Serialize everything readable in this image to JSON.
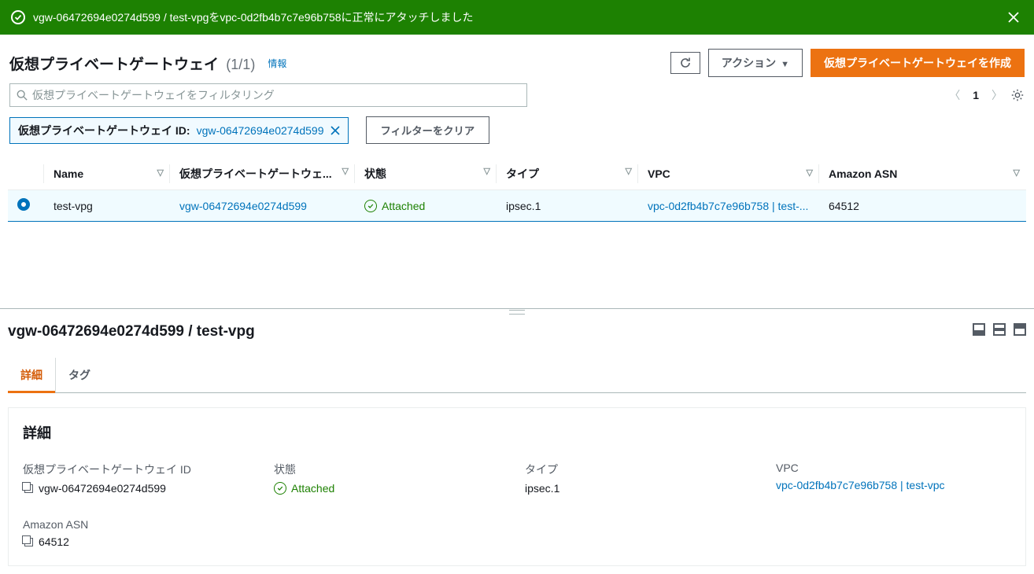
{
  "flash": {
    "message": "vgw-06472694e0274d599 / test-vpgをvpc-0d2fb4b7c7e96b758に正常にアタッチしました"
  },
  "header": {
    "title": "仮想プライベートゲートウェイ",
    "count": "(1/1)",
    "info_link": "情報",
    "actions_label": "アクション",
    "create_label": "仮想プライベートゲートウェイを作成"
  },
  "filter": {
    "placeholder": "仮想プライベートゲートウェイをフィルタリング",
    "token_key": "仮想プライベートゲートウェイ ID:",
    "token_value": "vgw-06472694e0274d599",
    "clear_label": "フィルターをクリア",
    "page_number": "1"
  },
  "table": {
    "columns": {
      "name": "Name",
      "vgw_id": "仮想プライベートゲートウェ...",
      "state": "状態",
      "type": "タイプ",
      "vpc": "VPC",
      "asn": "Amazon ASN"
    },
    "row": {
      "name": "test-vpg",
      "vgw_id": "vgw-06472694e0274d599",
      "state": "Attached",
      "type": "ipsec.1",
      "vpc": "vpc-0d2fb4b7c7e96b758 | test-...",
      "asn": "64512"
    }
  },
  "details": {
    "title": "vgw-06472694e0274d599 / test-vpg",
    "tabs": {
      "detail": "詳細",
      "tags": "タグ"
    },
    "card_title": "詳細",
    "fields": {
      "vgw_id_label": "仮想プライベートゲートウェイ ID",
      "vgw_id_value": "vgw-06472694e0274d599",
      "state_label": "状態",
      "state_value": "Attached",
      "type_label": "タイプ",
      "type_value": "ipsec.1",
      "vpc_label": "VPC",
      "vpc_value": "vpc-0d2fb4b7c7e96b758 | test-vpc",
      "asn_label": "Amazon ASN",
      "asn_value": "64512"
    }
  }
}
